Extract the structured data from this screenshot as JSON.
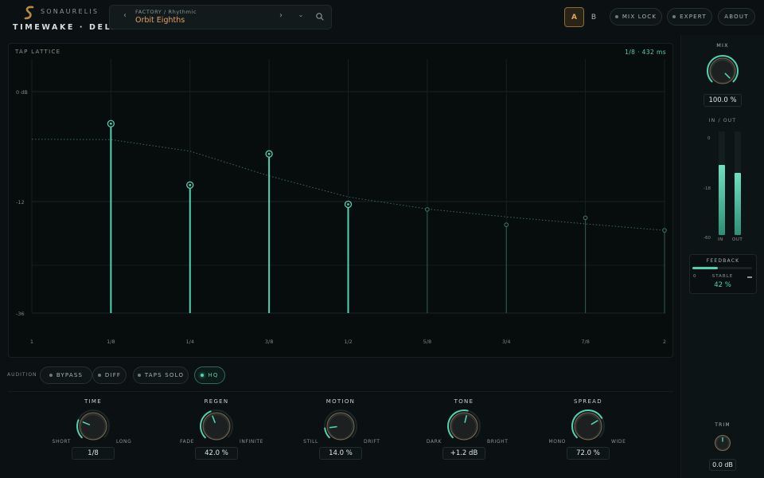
{
  "header": {
    "brand": "SONAURELIS",
    "product": "TIMEWAKE · DELAY",
    "preset_path": "FACTORY / Rhythmic",
    "preset_name": "Orbit Eighths",
    "prev_glyph": "‹",
    "next_glyph": "›",
    "menu_glyph": "⌄",
    "ab_a": "A",
    "ab_b": "B",
    "mix_lock": "MIX LOCK",
    "expert": "EXPERT",
    "about": "ABOUT"
  },
  "colors": {
    "accent": "#51d1ae",
    "preset_accent": "#e3a268",
    "background": "#0b1112"
  },
  "icons": [
    "logo-icon",
    "chevron-left-icon",
    "chevron-right-icon",
    "chevron-down-icon",
    "search-icon"
  ],
  "graph": {
    "title": "TAP LATTICE",
    "readout": "1/8 · 432 ms"
  },
  "chart_data": {
    "type": "scatter",
    "title": "TAP LATTICE",
    "y_tick_labels": [
      "0 dB",
      "-12",
      "-36"
    ],
    "x_tick_labels": [
      "1",
      "1/8",
      "1/4",
      "3/8",
      "1/2",
      "5/8",
      "3/4",
      "7/8",
      "2"
    ],
    "taps": [
      {
        "position": "1/8",
        "level_db": -3.5,
        "active": true
      },
      {
        "position": "1/4",
        "level_db": -10.2,
        "active": true
      },
      {
        "position": "3/8",
        "level_db": -6.8,
        "active": true
      },
      {
        "position": "1/2",
        "level_db": -12.6,
        "active": true
      },
      {
        "position": "5/8",
        "level_db": -13.7,
        "active": false
      },
      {
        "position": "3/4",
        "level_db": -17.0,
        "active": false
      },
      {
        "position": "7/8",
        "level_db": -15.5,
        "active": false
      },
      {
        "position": "2",
        "level_db": -18.2,
        "active": false
      }
    ],
    "decay_curve_db": [
      -3.5,
      -6.5,
      -9.2,
      -11.5,
      -13.6,
      -15.3,
      -16.8,
      -18.2
    ],
    "decay_curve_start_db": -3.5
  },
  "audition": {
    "label": "AUDITION",
    "buttons": [
      {
        "label": "BYPASS",
        "active": false
      },
      {
        "label": "DIFF",
        "active": false
      },
      {
        "label": "TAPS SOLO",
        "active": false
      },
      {
        "label": "HQ",
        "active": true
      }
    ]
  },
  "knobs": [
    {
      "title": "TIME",
      "min": "SHORT",
      "max": "LONG",
      "value": "1/8",
      "level": 0.25
    },
    {
      "title": "REGEN",
      "min": "FADE",
      "max": "INFINITE",
      "value": "42.0 %",
      "level": 0.42
    },
    {
      "title": "MOTION",
      "min": "STILL",
      "max": "DRIFT",
      "value": "14.0 %",
      "level": 0.14
    },
    {
      "title": "TONE",
      "min": "DARK",
      "max": "BRIGHT",
      "value": "+1.2 dB",
      "level": 0.55
    },
    {
      "title": "SPREAD",
      "min": "MONO",
      "max": "WIDE",
      "value": "72.0 %",
      "level": 0.72
    }
  ],
  "mix": {
    "label": "MIX",
    "value": "100.0 %",
    "level": 1.0
  },
  "meters": {
    "label": "IN  /  OUT",
    "scale": [
      "0",
      "-18",
      "-60"
    ],
    "in_label": "IN",
    "out_label": "OUT",
    "in_level": 0.68,
    "out_level": 0.6
  },
  "feedback": {
    "label": "FEEDBACK",
    "min": "0",
    "state": "STABLE",
    "value": "42 %",
    "level": 0.42
  },
  "trim": {
    "label": "TRIM",
    "value": "0.0 dB",
    "level": 0.5
  }
}
